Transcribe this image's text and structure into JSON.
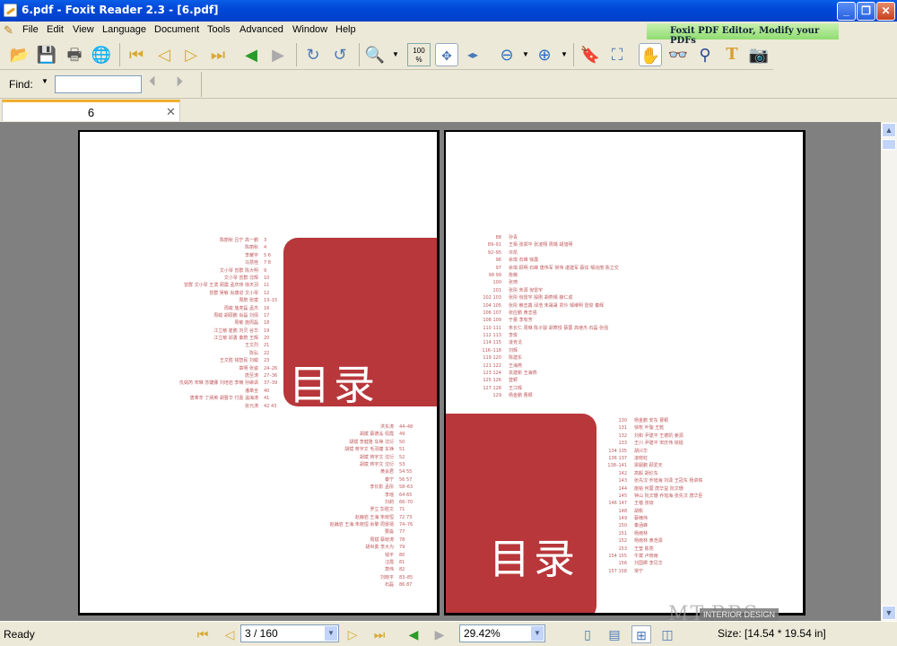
{
  "window": {
    "title": "6.pdf - Foxit Reader 2.3 - [6.pdf]"
  },
  "menu": [
    "File",
    "Edit",
    "View",
    "Language",
    "Document",
    "Tools",
    "Advanced",
    "Window",
    "Help"
  ],
  "promo": "Foxit PDF Editor, Modify your PDFs",
  "find": {
    "label": "Find:",
    "value": ""
  },
  "tab": {
    "label": "6"
  },
  "page_left": {
    "title": "目录",
    "toc1": [
      [
        "陈丽秋  吕宁  高一鹏",
        "3"
      ],
      [
        "陈丽秋",
        "4"
      ],
      [
        "李耀宇",
        "5 6"
      ],
      [
        "马慧桂",
        "7 8"
      ],
      [
        "文小琴  曾群  陈大明",
        "9"
      ],
      [
        "文小琴  曾群  沈辉",
        "10"
      ],
      [
        "曾群  文小琴  王滨  顾震  孟庆玮  徐天羽",
        "11"
      ],
      [
        "曾群  吴敏  肖康进  文小琴",
        "12"
      ],
      [
        "周蔚  张斌",
        "13–15"
      ],
      [
        "周峻  施虎磊  孟杰",
        "16"
      ],
      [
        "周峻  胡硕鹏  肖磊  刘倩",
        "17"
      ],
      [
        "周敏  施周磊",
        "18"
      ],
      [
        "江立敏  崔鹏  刘灵  谷华",
        "19"
      ],
      [
        "江立敏  邱勇  秦蔚  王辉",
        "20"
      ],
      [
        "王文烈",
        "21"
      ],
      [
        "陈弘",
        "22"
      ],
      [
        "王文胜  钱智民  刘峻",
        "23"
      ],
      [
        "章明  张姿",
        "24–26"
      ],
      [
        "唐至涛",
        "27–36"
      ],
      [
        "仇娟芮  宋琳  苏婕娜  刘培岩  李楠  孙綝讽",
        "37–39"
      ],
      [
        "潘革全",
        "40"
      ],
      [
        "唐革辛  丁炳英  胡晋华  付嘉  温海涛",
        "41"
      ],
      [
        "张元涛",
        "42 43"
      ]
    ],
    "toc2": [
      [
        "洪东涛",
        "44–48"
      ],
      [
        "胡斌  蔡德泓  侃霞",
        "49"
      ],
      [
        "胡斌  李健隆  车铮  沈衍",
        "50"
      ],
      [
        "胡斌  蒋宇文  毛羽婕  车铮",
        "51"
      ],
      [
        "胡斌  蒋宇文  沈衍",
        "52"
      ],
      [
        "胡斌  蒋宇文  沈衍",
        "53"
      ],
      [
        "黄会君",
        "54 55"
      ],
      [
        "秦宁",
        "56 57"
      ],
      [
        "李长影  孟彤",
        "58–63"
      ],
      [
        "李瑶",
        "64 65"
      ],
      [
        "刘莉",
        "66–70"
      ],
      [
        "罗立  彭胜文",
        "71"
      ],
      [
        "赵巍岩  王海  朱晓恒",
        "72 73"
      ],
      [
        "赵巍岩  王海  朱晓恒  余擎  周晏禧",
        "74–76"
      ],
      [
        "要淼",
        "77"
      ],
      [
        "周斌  蔡晓涛",
        "78"
      ],
      [
        "胡世勇  李大为",
        "79"
      ],
      [
        "钱平",
        "80"
      ],
      [
        "汪霞",
        "81"
      ],
      [
        "萧伟",
        "82"
      ],
      [
        "刘晓平",
        "83–85"
      ],
      [
        "石磊",
        "86 87"
      ]
    ]
  },
  "page_right": {
    "title": "目录",
    "toc1": [
      [
        "88",
        "孙青"
      ],
      [
        "89–91",
        "王栢  张郑平  张凌翔  周璐  胡旭明"
      ],
      [
        "92–95",
        "许凯"
      ],
      [
        "96",
        "余琪  石峰  徐露"
      ],
      [
        "97",
        "余琪  顾明  石峰  唐伟军  常伟  谌建军  蔡炫  邹兆丽  陈立交"
      ],
      [
        "98 99",
        "詹薇"
      ],
      [
        "100",
        "张琦"
      ],
      [
        "101",
        "张彤  朱源  倪雷宇"
      ],
      [
        "102 103",
        "张彤  倪雷宇  殷刚  胡燕晴  薛仁成"
      ],
      [
        "104 105",
        "张彤  赖志鑫  邱浩  朱晟晟  贾玲  邹维明  雷俊  秦辉"
      ],
      [
        "106 107",
        "张应鹏  黄志强"
      ],
      [
        "108 109",
        "于蕾  李有芳"
      ],
      [
        "110 111",
        "朱长仁  周琳  陈子骏  胡寒悦  蔡蓉  高继杰  石磊  张强"
      ],
      [
        "112 113",
        "李俊"
      ],
      [
        "114 115",
        "凌克戈"
      ],
      [
        "116–118",
        "刘辉"
      ],
      [
        "119 120",
        "陈建东"
      ],
      [
        "121 122",
        "王海燕"
      ],
      [
        "123 124",
        "袁建新  王海燕"
      ],
      [
        "125 126",
        "登颖"
      ],
      [
        "127 128",
        "王江辉"
      ],
      [
        "129",
        "杨金鹏  曹颖"
      ]
    ],
    "toc2": [
      [
        "130",
        "杨金鹏  安东  曹颖"
      ],
      [
        "131",
        "徐牧  叶璇  王乾"
      ],
      [
        "132",
        "刘和  尹建平  王德凯  姜源"
      ],
      [
        "133",
        "王川  尹建平  宋庆伟  徐挺"
      ],
      [
        "134 135",
        "胡兴华"
      ],
      [
        "136 137",
        "凌晓虹"
      ],
      [
        "138–141",
        "梁嗣鹏  顾爱天"
      ],
      [
        "142",
        "高毅  胡伦东"
      ],
      [
        "143",
        "张先汉  乔旭海  刘潇  王冠东  杨卓铁"
      ],
      [
        "144",
        "施铭  何蓉  唐华益  阮文珊"
      ],
      [
        "145",
        "钟山  阮文珊  乔旭海  张先汉  唐华臣"
      ],
      [
        "146 147",
        "王蓓  张琼"
      ],
      [
        "148",
        "胡帆"
      ],
      [
        "149",
        "蔡楠伟"
      ],
      [
        "150",
        "秦涵峰"
      ],
      [
        "151",
        "杨雨林"
      ],
      [
        "152",
        "杨雨林  黄浩源"
      ],
      [
        "153",
        "王莹  陈亮"
      ],
      [
        "154 155",
        "牛斌  卢晓雨"
      ],
      [
        "156",
        "刘国卿  李见华"
      ],
      [
        "157 158",
        "常宁"
      ]
    ]
  },
  "watermark": {
    "logo": "MT-BBS",
    "badge": "INTERIOR DESIGN"
  },
  "status": {
    "ready": "Ready",
    "page": "3 / 160",
    "zoom": "29.42%",
    "size": "Size: [14.54 * 19.54 in]"
  },
  "colors": {
    "title_bar": "#0148d8",
    "accent_red": "#b8373b",
    "toc_text": "#c0585c",
    "doc_bg": "#808080"
  }
}
